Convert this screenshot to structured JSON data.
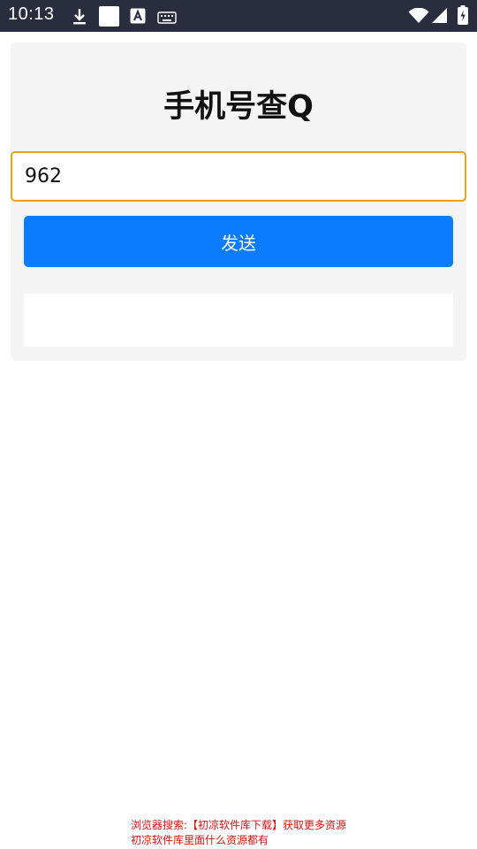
{
  "status_bar": {
    "time": "10:13",
    "icons": [
      "download-icon",
      "white-square-icon",
      "text-a-icon",
      "keyboard-icon",
      "wifi-icon",
      "signal-icon",
      "battery-icon"
    ]
  },
  "page": {
    "title": "手机号查Q",
    "input_value": "962",
    "send_label": "发送",
    "result_text": ""
  },
  "footer": {
    "line1": "浏览器搜索:【初凉软件库下载】获取更多资源",
    "line2": "初凉软件库里面什么资源都有",
    "color": "#e01010"
  },
  "colors": {
    "accent": "#0a7cff",
    "input_border": "#e8a317",
    "status_bar": "#2a2d3e"
  }
}
